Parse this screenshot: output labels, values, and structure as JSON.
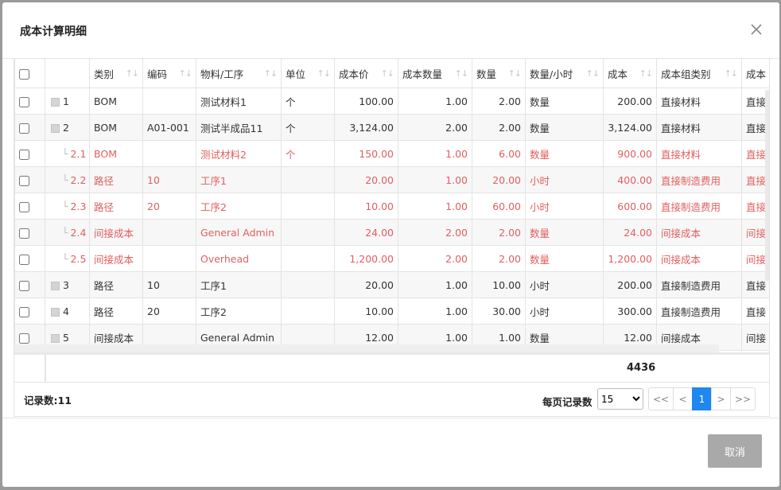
{
  "dialog": {
    "title": "成本计算明细",
    "cancel_label": "取消"
  },
  "grid": {
    "columns": [
      "类别",
      "编码",
      "物料/工序",
      "单位",
      "成本价",
      "成本数量",
      "数量",
      "数量/小时",
      "成本",
      "成本组类别",
      "成本"
    ],
    "rows": [
      {
        "no": "1",
        "category": "BOM",
        "code": "",
        "item": "测试材料1",
        "unit": "个",
        "unit_cost": "100.00",
        "cost_qty": "1.00",
        "qty": "2.00",
        "qty_hour": "数量",
        "cost": "200.00",
        "cost_group": "直接材料",
        "cost2": "直接"
      },
      {
        "no": "2",
        "category": "BOM",
        "code": "A01-001",
        "item": "测试半成品11",
        "unit": "个",
        "unit_cost": "3,124.00",
        "cost_qty": "2.00",
        "qty": "2.00",
        "qty_hour": "数量",
        "cost": "3,124.00",
        "cost_group": "直接材料",
        "cost2": "直接"
      },
      {
        "no": "2.1",
        "category": "BOM",
        "code": "",
        "item": "测试材料2",
        "unit": "个",
        "unit_cost": "150.00",
        "cost_qty": "1.00",
        "qty": "6.00",
        "qty_hour": "数量",
        "cost": "900.00",
        "cost_group": "直接材料",
        "cost2": "直接"
      },
      {
        "no": "2.2",
        "category": "路径",
        "code": "10",
        "item": "工序1",
        "unit": "",
        "unit_cost": "20.00",
        "cost_qty": "1.00",
        "qty": "20.00",
        "qty_hour": "小时",
        "cost": "400.00",
        "cost_group": "直接制造费用",
        "cost2": "直接"
      },
      {
        "no": "2.3",
        "category": "路径",
        "code": "20",
        "item": "工序2",
        "unit": "",
        "unit_cost": "10.00",
        "cost_qty": "1.00",
        "qty": "60.00",
        "qty_hour": "小时",
        "cost": "600.00",
        "cost_group": "直接制造费用",
        "cost2": "直接"
      },
      {
        "no": "2.4",
        "category": "间接成本",
        "code": "",
        "item": "General Admin",
        "unit": "",
        "unit_cost": "24.00",
        "cost_qty": "2.00",
        "qty": "2.00",
        "qty_hour": "数量",
        "cost": "24.00",
        "cost_group": "间接成本",
        "cost2": "间接"
      },
      {
        "no": "2.5",
        "category": "间接成本",
        "code": "",
        "item": "Overhead",
        "unit": "",
        "unit_cost": "1,200.00",
        "cost_qty": "2.00",
        "qty": "2.00",
        "qty_hour": "数量",
        "cost": "1,200.00",
        "cost_group": "间接成本",
        "cost2": "间接"
      },
      {
        "no": "3",
        "category": "路径",
        "code": "10",
        "item": "工序1",
        "unit": "",
        "unit_cost": "20.00",
        "cost_qty": "1.00",
        "qty": "10.00",
        "qty_hour": "小时",
        "cost": "200.00",
        "cost_group": "直接制造费用",
        "cost2": "直接"
      },
      {
        "no": "4",
        "category": "路径",
        "code": "20",
        "item": "工序2",
        "unit": "",
        "unit_cost": "10.00",
        "cost_qty": "1.00",
        "qty": "30.00",
        "qty_hour": "小时",
        "cost": "300.00",
        "cost_group": "直接制造费用",
        "cost2": "直接"
      },
      {
        "no": "5",
        "category": "间接成本",
        "code": "",
        "item": "General Admin",
        "unit": "",
        "unit_cost": "12.00",
        "cost_qty": "1.00",
        "qty": "1.00",
        "qty_hour": "数量",
        "cost": "12.00",
        "cost_group": "间接成本",
        "cost2": "间接"
      }
    ],
    "total_cost": "4436"
  },
  "footer": {
    "record_count": "记录数:11",
    "per_page_label": "每页记录数",
    "page_size": "15",
    "page_size_options": [
      "15"
    ],
    "pager": [
      "<<",
      "<",
      "1",
      ">",
      ">>"
    ],
    "current_page": "1"
  },
  "colors": {
    "child_row_text": "#e0605f",
    "active_page": "#1e87f0",
    "cancel_button": "#a9a9a9"
  }
}
